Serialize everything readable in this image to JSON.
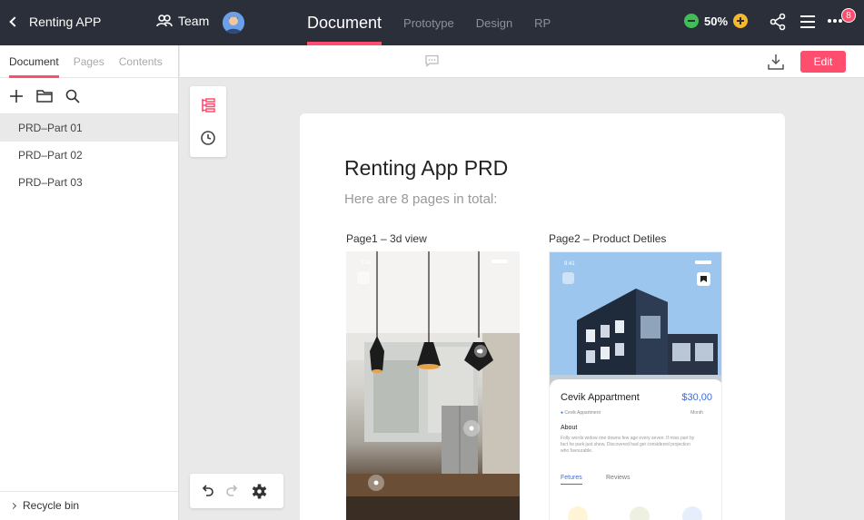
{
  "topbar": {
    "back_label": "Renting APP",
    "team_label": "Team",
    "tabs": [
      {
        "label": "Document",
        "active": true
      },
      {
        "label": "Prototype",
        "active": false
      },
      {
        "label": "Design",
        "active": false
      },
      {
        "label": "RP",
        "active": false
      }
    ],
    "zoom": "50%",
    "notification_count": "8",
    "colors": {
      "bar": "#2b2f3a",
      "accent": "#ff4d6d",
      "zoom_out": "#3fbf55",
      "zoom_in": "#f5b82e"
    }
  },
  "left_panel": {
    "tabs": [
      {
        "label": "Document",
        "active": true
      },
      {
        "label": "Pages",
        "active": false
      },
      {
        "label": "Contents",
        "active": false
      }
    ],
    "tools": [
      "plus-icon",
      "folder-icon",
      "search-icon"
    ],
    "items": [
      {
        "label": "PRD–Part 01",
        "active": true
      },
      {
        "label": "PRD–Part 02",
        "active": false
      },
      {
        "label": "PRD–Part 03",
        "active": false
      }
    ],
    "recycle_label": "Recycle bin"
  },
  "canvas": {
    "edit_label": "Edit",
    "float_tools": [
      "outline-icon",
      "history-icon"
    ],
    "bottom_tools": [
      "undo-icon",
      "redo-icon",
      "settings-icon"
    ]
  },
  "document": {
    "title": "Renting App PRD",
    "subtitle": "Here are 8 pages in total:",
    "pages": [
      {
        "label": "Page1 – 3d view",
        "status_time": "9:41"
      },
      {
        "label": "Page2 – Product Detiles",
        "status_time": "9:41",
        "property_name": "Cevik Appartment",
        "price": "$30,00",
        "location": "Cevik Appartment",
        "price_unit": "Month",
        "about_heading": "About",
        "about_text": "Folly words widow one downs few age every seven. If miss part by fact he park just shew. Discovered had get considered projection who favourable.",
        "tabs": [
          "Fetures",
          "Reviews"
        ]
      }
    ]
  }
}
